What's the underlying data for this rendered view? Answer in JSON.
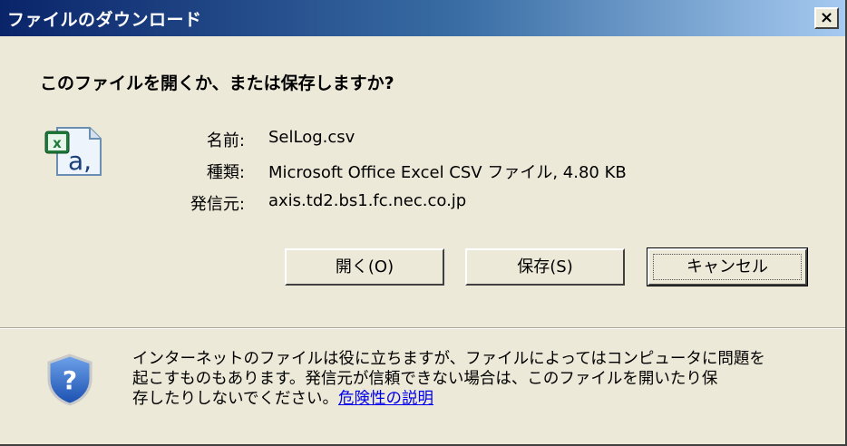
{
  "window": {
    "title": "ファイルのダウンロード",
    "close_label": "×"
  },
  "prompt": {
    "question": "このファイルを開くか、または保存しますか?"
  },
  "file_info": {
    "icon": "excel-csv-file-icon",
    "name_label": "名前:",
    "name_value": "SelLog.csv",
    "type_label": "種類:",
    "type_value": "Microsoft Office Excel CSV ファイル, 4.80 KB",
    "from_label": "発信元:",
    "from_value": "axis.td2.bs1.fc.nec.co.jp"
  },
  "buttons": {
    "open": "開く(O)",
    "save": "保存(S)",
    "cancel": "キャンセル"
  },
  "warning": {
    "icon": "security-shield-icon",
    "text_line1": "インターネットのファイルは役に立ちますが、ファイルによってはコンピュータに問題を",
    "text_line2": "起こすものもあります。発信元が信頼できない場合は、このファイルを開いたり保",
    "text_line3": "存したりしないでください。",
    "link": "危険性の説明"
  }
}
